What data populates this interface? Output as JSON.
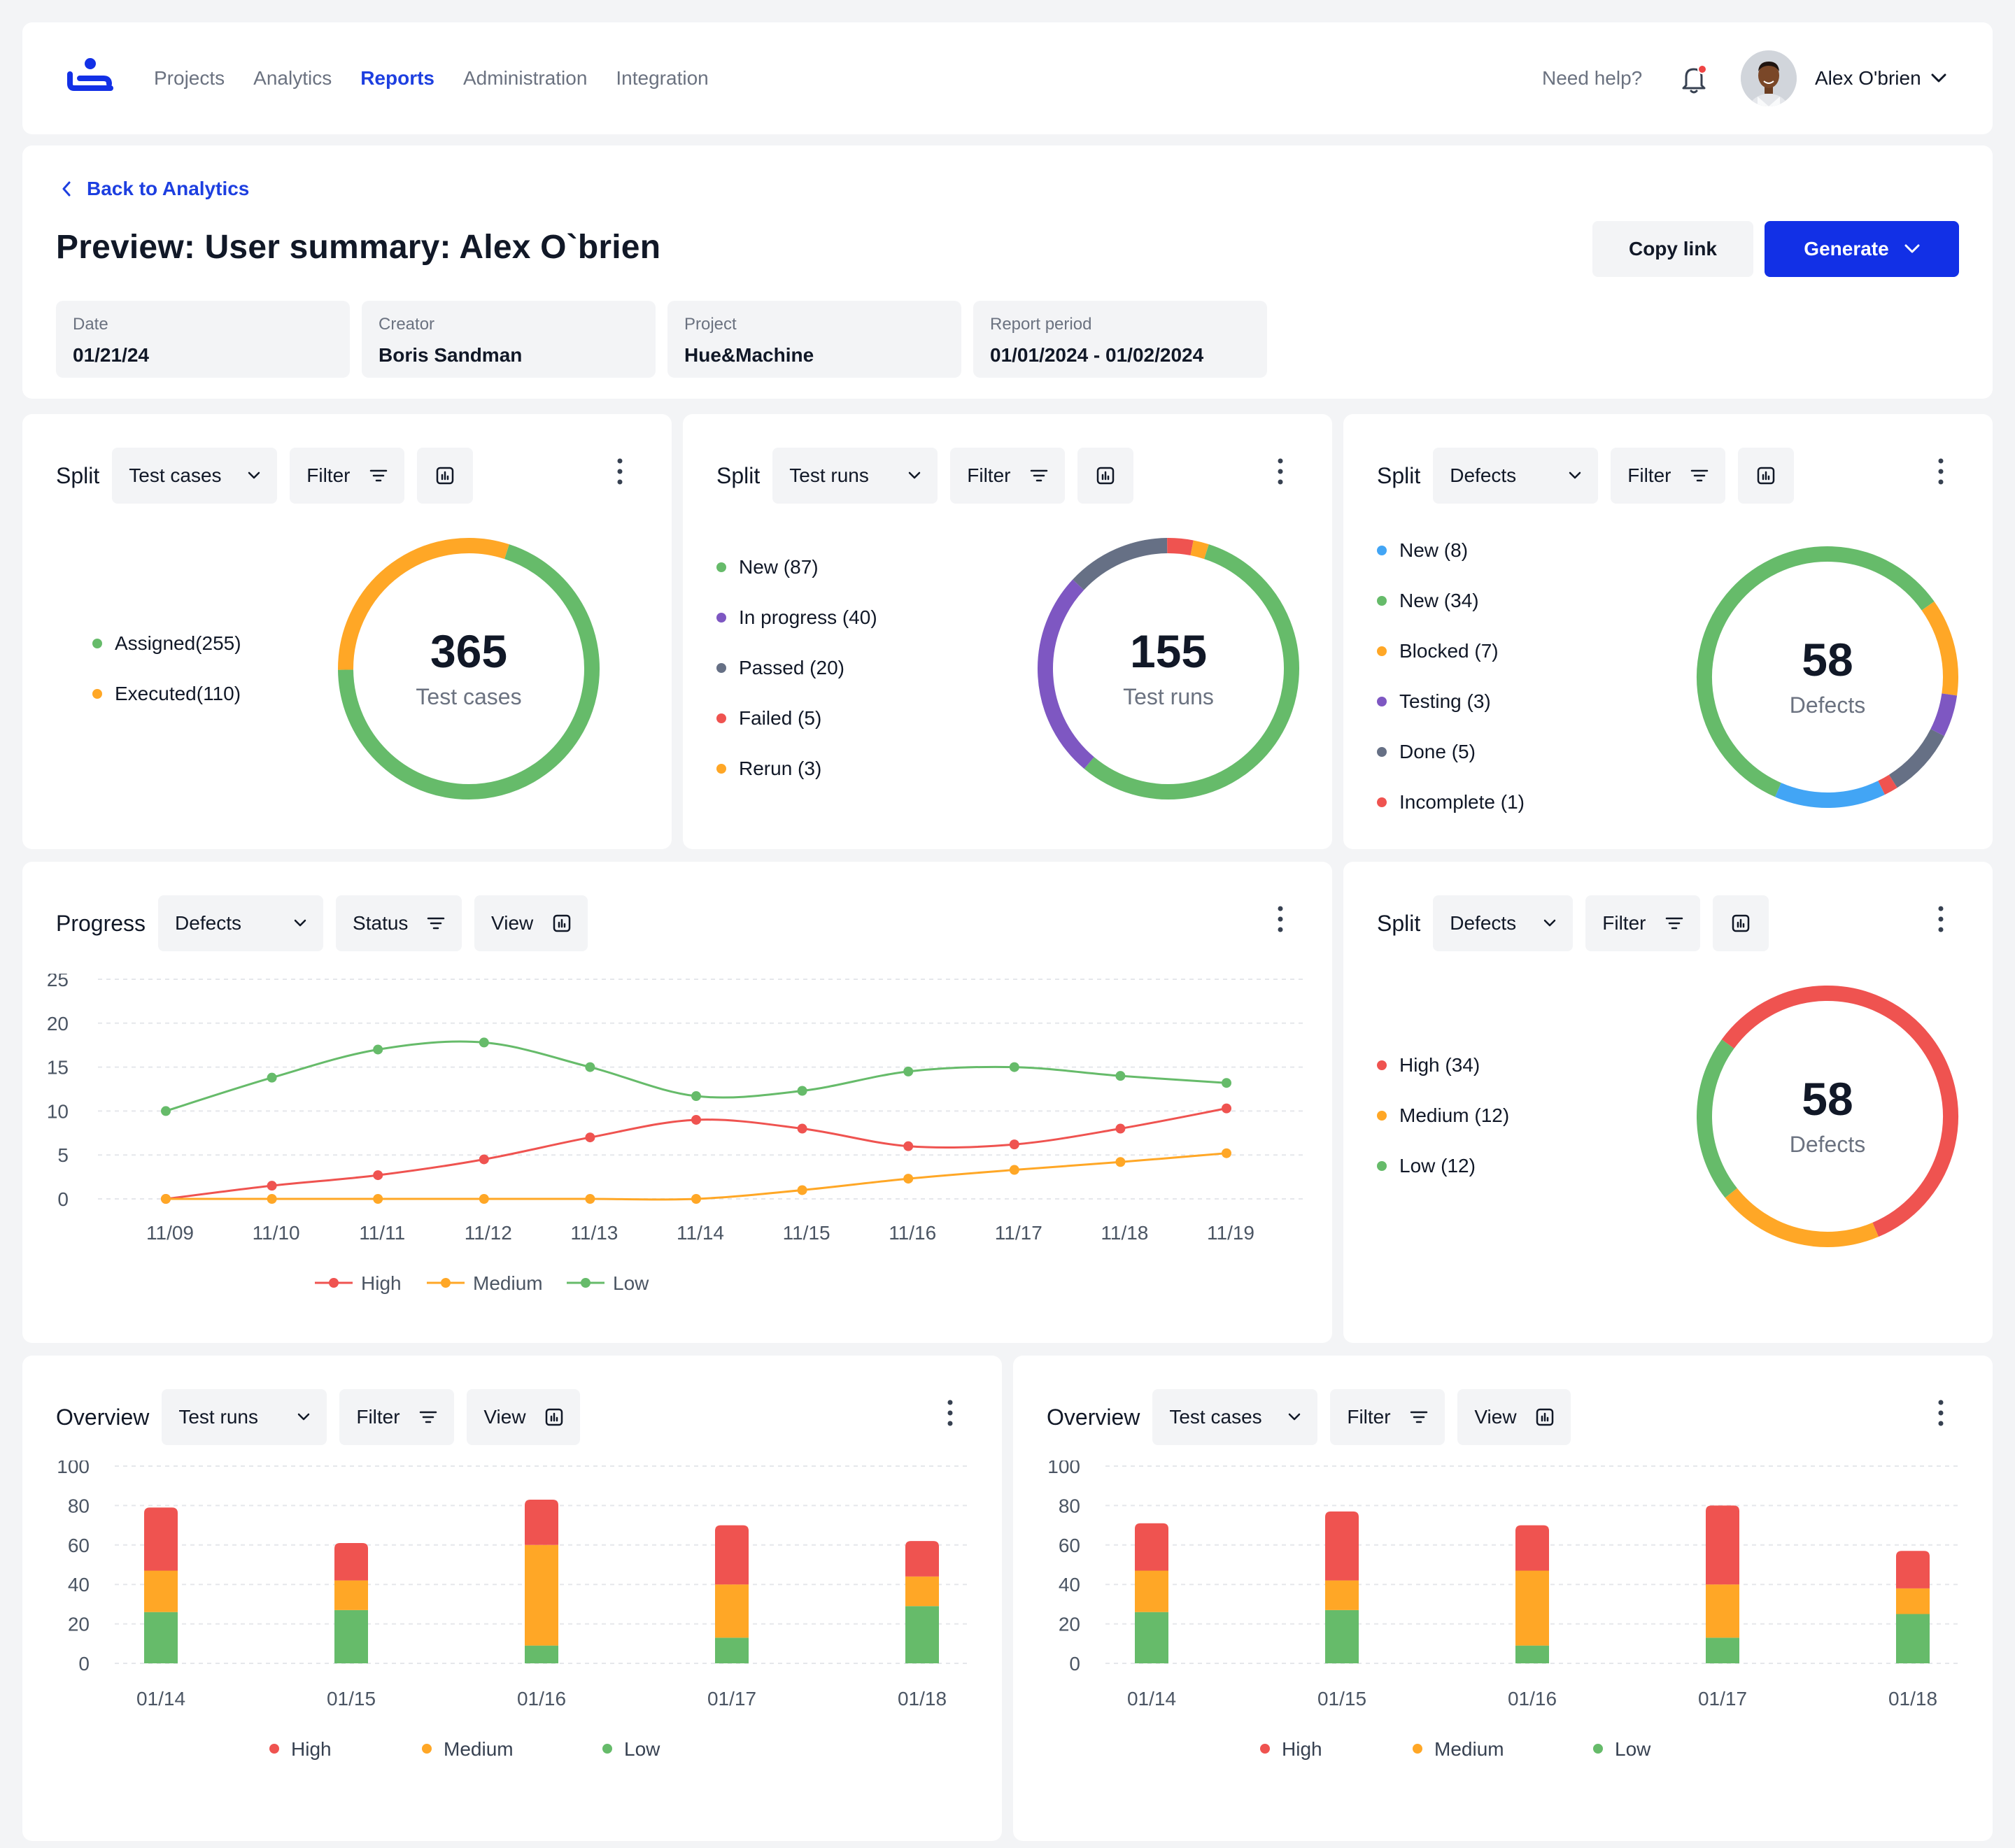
{
  "nav": {
    "items": [
      {
        "label": "Projects"
      },
      {
        "label": "Analytics"
      },
      {
        "label": "Reports",
        "active": true
      },
      {
        "label": "Administration"
      },
      {
        "label": "Integration"
      }
    ],
    "help": "Need help?",
    "user_name": "Alex O'brien"
  },
  "header": {
    "back": "Back to Analytics",
    "title": "Preview: User summary: Alex O`brien",
    "copy_link": "Copy link",
    "generate": "Generate",
    "info": [
      {
        "label": "Date",
        "value": "01/21/24"
      },
      {
        "label": "Creator",
        "value": "Boris Sandman"
      },
      {
        "label": "Project",
        "value": "Hue&Machine"
      },
      {
        "label": "Report period",
        "value": "01/01/2024 - 01/02/2024"
      }
    ]
  },
  "colors": {
    "green": "#66bb6a",
    "orange": "#ffa726",
    "red": "#ef5350",
    "purple": "#7e57c2",
    "grey": "#667085",
    "blue": "#42a5f5",
    "accent": "#1230e6"
  },
  "widgets": {
    "split_test_cases": {
      "title": "Split",
      "select": "Test cases",
      "filter": "Filter",
      "total": "365",
      "total_label": "Test cases",
      "legend": [
        {
          "label": "Assigned(255)",
          "value": 255,
          "color": "#66bb6a"
        },
        {
          "label": "Executed(110)",
          "value": 110,
          "color": "#ffa726"
        }
      ]
    },
    "split_test_runs": {
      "title": "Split",
      "select": "Test runs",
      "filter": "Filter",
      "total": "155",
      "total_label": "Test runs",
      "legend": [
        {
          "label": "New (87)",
          "value": 87,
          "color": "#66bb6a"
        },
        {
          "label": "In progress (40)",
          "value": 40,
          "color": "#7e57c2"
        },
        {
          "label": "Passed (20)",
          "value": 20,
          "color": "#667085"
        },
        {
          "label": "Failed (5)",
          "value": 5,
          "color": "#ef5350"
        },
        {
          "label": "Rerun (3)",
          "value": 3,
          "color": "#ffa726"
        }
      ]
    },
    "split_defects_status": {
      "title": "Split",
      "select": "Defects",
      "filter": "Filter",
      "total": "58",
      "total_label": "Defects",
      "legend": [
        {
          "label": "New (8)",
          "value": 8,
          "color": "#42a5f5"
        },
        {
          "label": "New (34)",
          "value": 34,
          "color": "#66bb6a"
        },
        {
          "label": "Blocked (7)",
          "value": 7,
          "color": "#ffa726"
        },
        {
          "label": "Testing (3)",
          "value": 3,
          "color": "#7e57c2"
        },
        {
          "label": "Done (5)",
          "value": 5,
          "color": "#667085"
        },
        {
          "label": "Incomplete (1)",
          "value": 1,
          "color": "#ef5350"
        }
      ]
    },
    "progress": {
      "title": "Progress",
      "select": "Defects",
      "filter": "Status",
      "view": "View"
    },
    "split_defects_priority": {
      "title": "Split",
      "select": "Defects",
      "filter": "Filter",
      "total": "58",
      "total_label": "Defects",
      "legend": [
        {
          "label": "High (34)",
          "value": 34,
          "color": "#ef5350"
        },
        {
          "label": "Medium (12)",
          "value": 12,
          "color": "#ffa726"
        },
        {
          "label": "Low (12)",
          "value": 12,
          "color": "#66bb6a"
        }
      ]
    },
    "overview_runs": {
      "title": "Overview",
      "select": "Test runs",
      "filter": "Filter",
      "view": "View"
    },
    "overview_cases": {
      "title": "Overview",
      "select": "Test cases",
      "filter": "Filter",
      "view": "View"
    }
  },
  "chart_data": [
    {
      "type": "line",
      "x": [
        "11/09",
        "11/10",
        "11/11",
        "11/12",
        "11/13",
        "11/14",
        "11/15",
        "11/16",
        "11/17",
        "11/18",
        "11/19"
      ],
      "series": [
        {
          "name": "High",
          "color": "#ef5350",
          "values": [
            0,
            1.5,
            2.7,
            4.5,
            7,
            9,
            8,
            6,
            6.2,
            8,
            10.3
          ]
        },
        {
          "name": "Medium",
          "color": "#ffa726",
          "values": [
            0,
            0,
            0,
            0,
            0,
            0,
            1,
            2.3,
            3.3,
            4.2,
            5.2
          ]
        },
        {
          "name": "Low",
          "color": "#66bb6a",
          "values": [
            10,
            13.8,
            17,
            17.8,
            15,
            11.7,
            12.3,
            14.5,
            15,
            14,
            13.2
          ]
        }
      ],
      "yticks": [
        0,
        5,
        10,
        15,
        20,
        25
      ],
      "ylim": [
        0,
        25
      ],
      "grid": true,
      "legend": "bottom"
    },
    {
      "type": "bar",
      "stacked": true,
      "categories": [
        "01/14",
        "01/15",
        "01/16",
        "01/17",
        "01/18"
      ],
      "series": [
        {
          "name": "Low",
          "color": "#66bb6a",
          "values": [
            26,
            27,
            9,
            13,
            29
          ]
        },
        {
          "name": "Medium",
          "color": "#ffa726",
          "values": [
            21,
            15,
            51,
            27,
            15
          ]
        },
        {
          "name": "High",
          "color": "#ef5350",
          "values": [
            32,
            19,
            23,
            30,
            18
          ]
        }
      ],
      "yticks": [
        0,
        20,
        40,
        60,
        80,
        100
      ],
      "ylim": [
        0,
        100
      ],
      "grid": true,
      "legend": "bottom"
    },
    {
      "type": "bar",
      "stacked": true,
      "categories": [
        "01/14",
        "01/15",
        "01/16",
        "01/17",
        "01/18"
      ],
      "series": [
        {
          "name": "Low",
          "color": "#66bb6a",
          "values": [
            26,
            27,
            9,
            13,
            25
          ]
        },
        {
          "name": "Medium",
          "color": "#ffa726",
          "values": [
            21,
            15,
            38,
            27,
            13
          ]
        },
        {
          "name": "High",
          "color": "#ef5350",
          "values": [
            24,
            35,
            23,
            40,
            19
          ]
        }
      ],
      "yticks": [
        0,
        20,
        40,
        60,
        80,
        100
      ],
      "ylim": [
        0,
        100
      ],
      "grid": true,
      "legend": "bottom"
    }
  ]
}
